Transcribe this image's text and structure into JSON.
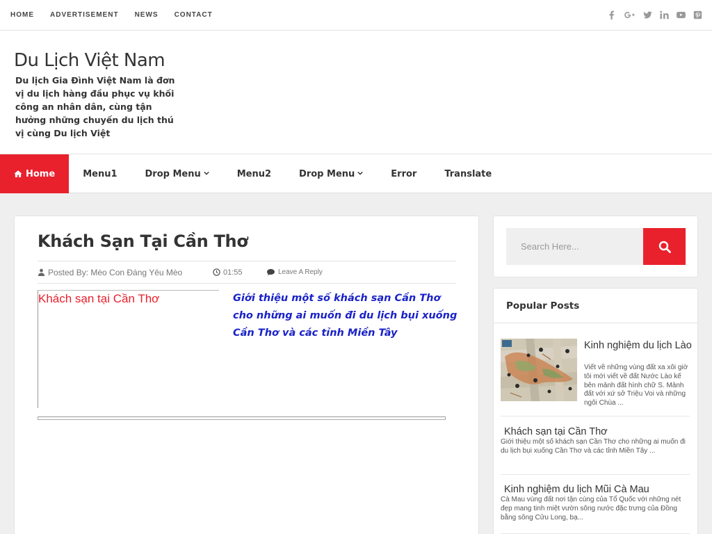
{
  "topnav": {
    "links": [
      "HOME",
      "ADVERTISEMENT",
      "NEWS",
      "CONTACT"
    ],
    "social": [
      "facebook-icon",
      "google-plus-icon",
      "twitter-icon",
      "linkedin-icon",
      "youtube-icon",
      "pinterest-icon"
    ]
  },
  "header": {
    "title": "Du Lịch Việt Nam",
    "description": "Du lịch Gia Đình Việt Nam là đơn vị du lịch hàng đầu phục vụ khối công an nhân dân, cùng tận hưởng những chuyến du lịch thú vị cùng Du lịch Việt"
  },
  "mainnav": {
    "items": [
      {
        "label": "Home",
        "active": true
      },
      {
        "label": "Menu1"
      },
      {
        "label": "Drop Menu",
        "dropdown": true
      },
      {
        "label": "Menu2"
      },
      {
        "label": "Drop Menu",
        "dropdown": true
      },
      {
        "label": "Error"
      },
      {
        "label": "Translate"
      }
    ]
  },
  "post": {
    "title": "Khách Sạn Tại Cần Thơ",
    "author": "Posted By: Mèo Con Đáng Yêu Mèo",
    "time": "01:55",
    "reply": "Leave A Reply",
    "image_alt": "Khách sạn tại Cần Thơ",
    "intro": "Giới thiệu một số khách sạn Cần Thơ cho những ai muốn đi du lịch bụi xuống Cần Thơ và các tỉnh Miền Tây"
  },
  "search": {
    "placeholder": "Search Here..."
  },
  "popular": {
    "heading": "Popular Posts",
    "posts": [
      {
        "title": "Kinh nghiệm du lịch Lào",
        "snippet": "Viết về những vùng đất xa xôi giờ tôi mới viết về đất Nước Lào kế bên mảnh đất hình chữ S. Mảnh đất với xứ sở Triệu Voi và những ngôi Chùa ..."
      },
      {
        "title": "Khách sạn tại Cần Thơ",
        "snippet": "Giới thiệu một số khách sạn Cần Thơ cho những ai muốn đi du lịch bụi xuống Cần Thơ và các tỉnh Miền Tây ..."
      },
      {
        "title": "Kinh nghiệm du lịch Mũi Cà Mau",
        "snippet": "Cà Mau vùng đất nơi tận cùng của Tổ Quốc  với những nét đẹp mang tinh miệt vườn sông nước đặc trưng của Đồng bằng sông Cửu Long, bạ..."
      }
    ]
  },
  "colors": {
    "accent": "#e9212d",
    "intro_text": "#1a22c8",
    "background": "#efefef"
  }
}
